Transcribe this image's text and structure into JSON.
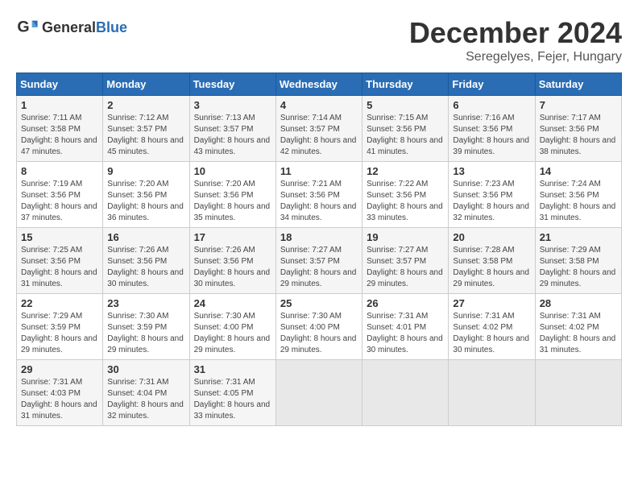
{
  "header": {
    "logo_general": "General",
    "logo_blue": "Blue",
    "month": "December 2024",
    "location": "Seregelyes, Fejer, Hungary"
  },
  "days_of_week": [
    "Sunday",
    "Monday",
    "Tuesday",
    "Wednesday",
    "Thursday",
    "Friday",
    "Saturday"
  ],
  "weeks": [
    [
      {
        "day": "1",
        "sunrise": "Sunrise: 7:11 AM",
        "sunset": "Sunset: 3:58 PM",
        "daylight": "Daylight: 8 hours and 47 minutes."
      },
      {
        "day": "2",
        "sunrise": "Sunrise: 7:12 AM",
        "sunset": "Sunset: 3:57 PM",
        "daylight": "Daylight: 8 hours and 45 minutes."
      },
      {
        "day": "3",
        "sunrise": "Sunrise: 7:13 AM",
        "sunset": "Sunset: 3:57 PM",
        "daylight": "Daylight: 8 hours and 43 minutes."
      },
      {
        "day": "4",
        "sunrise": "Sunrise: 7:14 AM",
        "sunset": "Sunset: 3:57 PM",
        "daylight": "Daylight: 8 hours and 42 minutes."
      },
      {
        "day": "5",
        "sunrise": "Sunrise: 7:15 AM",
        "sunset": "Sunset: 3:56 PM",
        "daylight": "Daylight: 8 hours and 41 minutes."
      },
      {
        "day": "6",
        "sunrise": "Sunrise: 7:16 AM",
        "sunset": "Sunset: 3:56 PM",
        "daylight": "Daylight: 8 hours and 39 minutes."
      },
      {
        "day": "7",
        "sunrise": "Sunrise: 7:17 AM",
        "sunset": "Sunset: 3:56 PM",
        "daylight": "Daylight: 8 hours and 38 minutes."
      }
    ],
    [
      {
        "day": "8",
        "sunrise": "Sunrise: 7:19 AM",
        "sunset": "Sunset: 3:56 PM",
        "daylight": "Daylight: 8 hours and 37 minutes."
      },
      {
        "day": "9",
        "sunrise": "Sunrise: 7:20 AM",
        "sunset": "Sunset: 3:56 PM",
        "daylight": "Daylight: 8 hours and 36 minutes."
      },
      {
        "day": "10",
        "sunrise": "Sunrise: 7:20 AM",
        "sunset": "Sunset: 3:56 PM",
        "daylight": "Daylight: 8 hours and 35 minutes."
      },
      {
        "day": "11",
        "sunrise": "Sunrise: 7:21 AM",
        "sunset": "Sunset: 3:56 PM",
        "daylight": "Daylight: 8 hours and 34 minutes."
      },
      {
        "day": "12",
        "sunrise": "Sunrise: 7:22 AM",
        "sunset": "Sunset: 3:56 PM",
        "daylight": "Daylight: 8 hours and 33 minutes."
      },
      {
        "day": "13",
        "sunrise": "Sunrise: 7:23 AM",
        "sunset": "Sunset: 3:56 PM",
        "daylight": "Daylight: 8 hours and 32 minutes."
      },
      {
        "day": "14",
        "sunrise": "Sunrise: 7:24 AM",
        "sunset": "Sunset: 3:56 PM",
        "daylight": "Daylight: 8 hours and 31 minutes."
      }
    ],
    [
      {
        "day": "15",
        "sunrise": "Sunrise: 7:25 AM",
        "sunset": "Sunset: 3:56 PM",
        "daylight": "Daylight: 8 hours and 31 minutes."
      },
      {
        "day": "16",
        "sunrise": "Sunrise: 7:26 AM",
        "sunset": "Sunset: 3:56 PM",
        "daylight": "Daylight: 8 hours and 30 minutes."
      },
      {
        "day": "17",
        "sunrise": "Sunrise: 7:26 AM",
        "sunset": "Sunset: 3:56 PM",
        "daylight": "Daylight: 8 hours and 30 minutes."
      },
      {
        "day": "18",
        "sunrise": "Sunrise: 7:27 AM",
        "sunset": "Sunset: 3:57 PM",
        "daylight": "Daylight: 8 hours and 29 minutes."
      },
      {
        "day": "19",
        "sunrise": "Sunrise: 7:27 AM",
        "sunset": "Sunset: 3:57 PM",
        "daylight": "Daylight: 8 hours and 29 minutes."
      },
      {
        "day": "20",
        "sunrise": "Sunrise: 7:28 AM",
        "sunset": "Sunset: 3:58 PM",
        "daylight": "Daylight: 8 hours and 29 minutes."
      },
      {
        "day": "21",
        "sunrise": "Sunrise: 7:29 AM",
        "sunset": "Sunset: 3:58 PM",
        "daylight": "Daylight: 8 hours and 29 minutes."
      }
    ],
    [
      {
        "day": "22",
        "sunrise": "Sunrise: 7:29 AM",
        "sunset": "Sunset: 3:59 PM",
        "daylight": "Daylight: 8 hours and 29 minutes."
      },
      {
        "day": "23",
        "sunrise": "Sunrise: 7:30 AM",
        "sunset": "Sunset: 3:59 PM",
        "daylight": "Daylight: 8 hours and 29 minutes."
      },
      {
        "day": "24",
        "sunrise": "Sunrise: 7:30 AM",
        "sunset": "Sunset: 4:00 PM",
        "daylight": "Daylight: 8 hours and 29 minutes."
      },
      {
        "day": "25",
        "sunrise": "Sunrise: 7:30 AM",
        "sunset": "Sunset: 4:00 PM",
        "daylight": "Daylight: 8 hours and 29 minutes."
      },
      {
        "day": "26",
        "sunrise": "Sunrise: 7:31 AM",
        "sunset": "Sunset: 4:01 PM",
        "daylight": "Daylight: 8 hours and 30 minutes."
      },
      {
        "day": "27",
        "sunrise": "Sunrise: 7:31 AM",
        "sunset": "Sunset: 4:02 PM",
        "daylight": "Daylight: 8 hours and 30 minutes."
      },
      {
        "day": "28",
        "sunrise": "Sunrise: 7:31 AM",
        "sunset": "Sunset: 4:02 PM",
        "daylight": "Daylight: 8 hours and 31 minutes."
      }
    ],
    [
      {
        "day": "29",
        "sunrise": "Sunrise: 7:31 AM",
        "sunset": "Sunset: 4:03 PM",
        "daylight": "Daylight: 8 hours and 31 minutes."
      },
      {
        "day": "30",
        "sunrise": "Sunrise: 7:31 AM",
        "sunset": "Sunset: 4:04 PM",
        "daylight": "Daylight: 8 hours and 32 minutes."
      },
      {
        "day": "31",
        "sunrise": "Sunrise: 7:31 AM",
        "sunset": "Sunset: 4:05 PM",
        "daylight": "Daylight: 8 hours and 33 minutes."
      },
      null,
      null,
      null,
      null
    ]
  ]
}
